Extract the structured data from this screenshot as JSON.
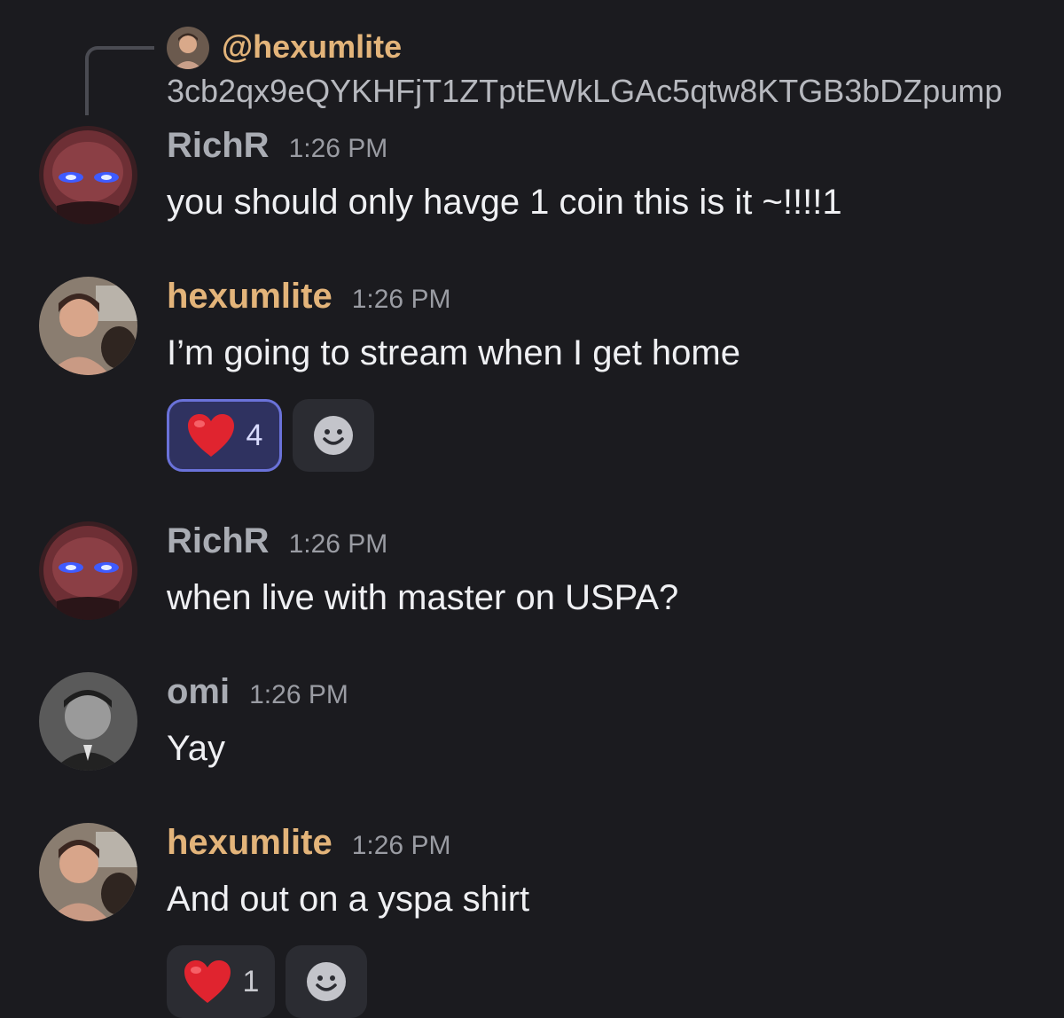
{
  "reply": {
    "author": "@hexumlite",
    "text": "3cb2qx9eQYKHFjT1ZTptEWkLGAc5qtw8KTGB3bDZpump"
  },
  "messages": [
    {
      "author": "RichR",
      "author_color": "#a9acb3",
      "avatar": "glowing-eyes-avatar",
      "time": "1:26 PM",
      "text": "you should only havge 1 coin this is it ~!!!!1"
    },
    {
      "author": "hexumlite",
      "author_color": "#e3b47a",
      "avatar": "hexumlite-avatar",
      "time": "1:26 PM",
      "text": "I’m going to stream when I get home",
      "reaction": {
        "emoji": "heart-icon",
        "count": "4",
        "active": true
      }
    },
    {
      "author": "RichR",
      "author_color": "#a9acb3",
      "avatar": "glowing-eyes-avatar",
      "time": "1:26 PM",
      "text": "when live with master on USPA?"
    },
    {
      "author": "omi",
      "author_color": "#a9acb3",
      "avatar": "omi-avatar",
      "time": "1:26 PM",
      "text": "Yay"
    },
    {
      "author": "hexumlite",
      "author_color": "#e3b47a",
      "avatar": "hexumlite-avatar",
      "time": "1:26 PM",
      "text": "And out on a yspa shirt",
      "reaction": {
        "emoji": "heart-icon",
        "count": "1",
        "active": false
      }
    }
  ],
  "colors": {
    "background": "#1b1b1f",
    "reaction_active_bg": "#2f3260",
    "reaction_active_border": "#6a72d9",
    "reaction_bg": "#2b2c32"
  }
}
